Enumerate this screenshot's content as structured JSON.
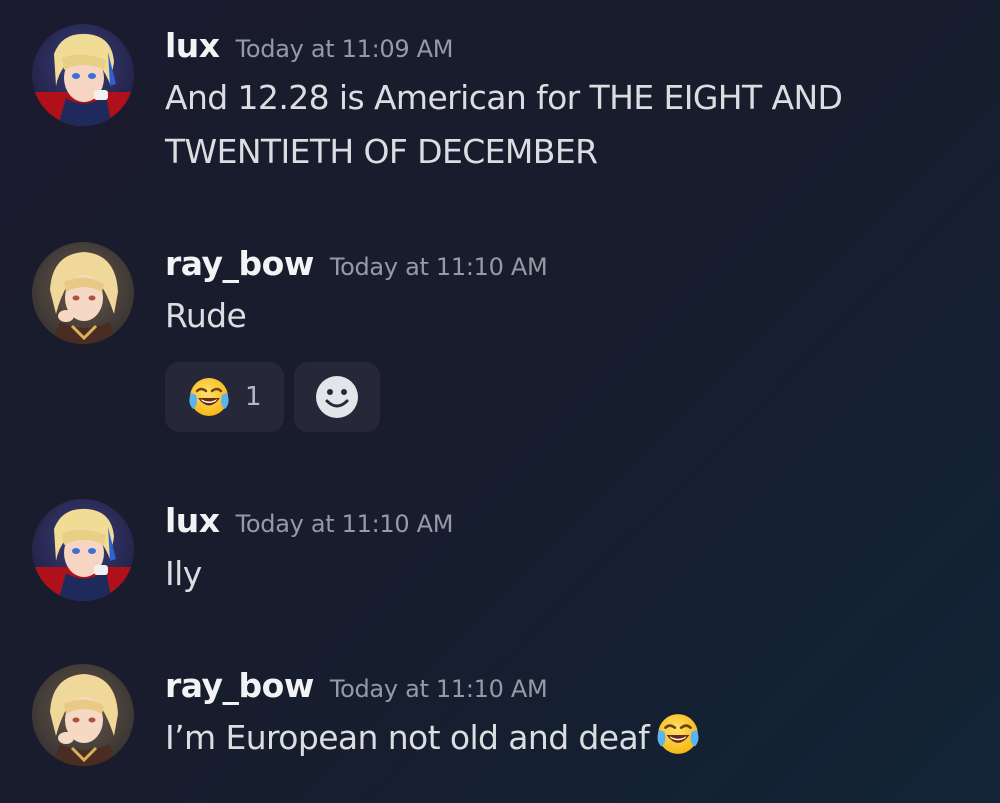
{
  "messages": [
    {
      "username": "lux",
      "timestamp": "Today at 11:09 AM",
      "text_lines": [
        "And 12.28 is American for THE EIGHT AND",
        "TWENTIETH OF DECEMBER"
      ]
    },
    {
      "username": "ray_bow",
      "timestamp": "Today at 11:10 AM",
      "text": "Rude",
      "reactions": [
        {
          "emoji": "joy-emoji",
          "count": "1"
        },
        {
          "emoji": "add-reaction-smiley-icon"
        }
      ]
    },
    {
      "username": "lux",
      "timestamp": "Today at 11:10 AM",
      "text": "Ily"
    },
    {
      "username": "ray_bow",
      "timestamp": "Today at 11:10 AM",
      "text": "I’m European not old and deaf",
      "trailing_emoji": "joy-emoji"
    }
  ],
  "colors": {
    "username": "#f2f3f5",
    "timestamp": "#949ba4",
    "text": "#dbdee1",
    "reaction_bg": "#26283a"
  }
}
